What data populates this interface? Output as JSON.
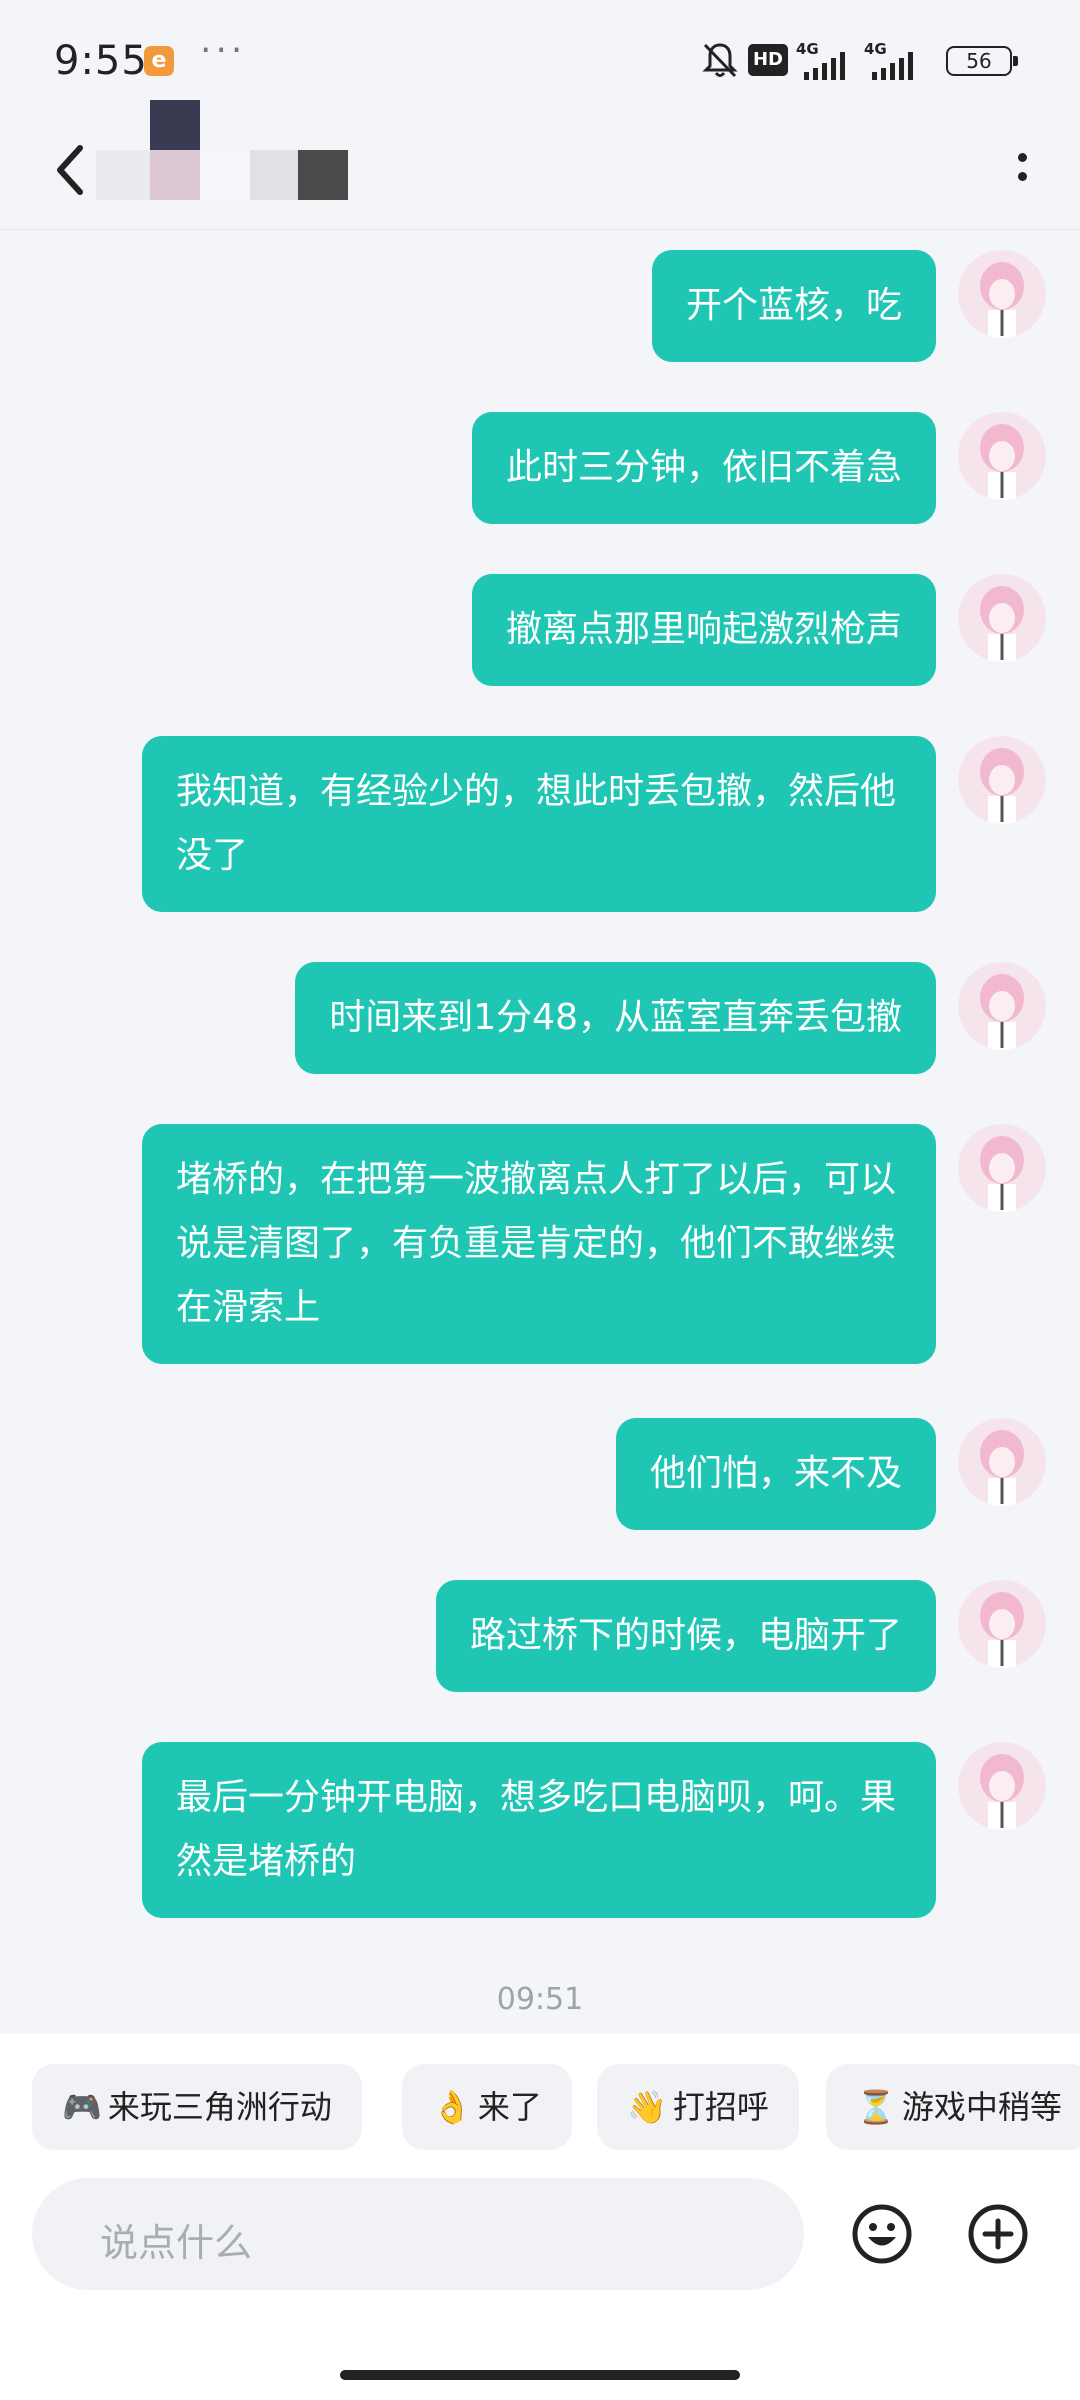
{
  "status_bar": {
    "time": "9:55",
    "app_badge": "e",
    "more": "···",
    "hd_label": "HD",
    "net1": "4G",
    "net2": "4G",
    "battery": "56"
  },
  "messages": [
    {
      "text": "开个蓝核，吃"
    },
    {
      "text": "此时三分钟，依旧不着急"
    },
    {
      "text": "撤离点那里响起激烈枪声"
    },
    {
      "text": "我知道，有经验少的，想此时丢包撤，然后他没了"
    },
    {
      "text": "时间来到1分48，从蓝室直奔丢包撤"
    },
    {
      "text": "堵桥的，在把第一波撤离点人打了以后，可以说是清图了，有负重是肯定的，他们不敢继续在滑索上"
    },
    {
      "text": "他们怕，来不及"
    },
    {
      "text": "路过桥下的时候，电脑开了"
    },
    {
      "text": "最后一分钟开电脑，想多吃口电脑呗，呵。果然是堵桥的"
    }
  ],
  "timestamp": "09:51",
  "quick_replies": [
    {
      "icon": "🎮",
      "label": "来玩三角洲行动"
    },
    {
      "icon": "👌",
      "label": "来了"
    },
    {
      "icon": "👋",
      "label": "打招呼"
    },
    {
      "icon": "⏳",
      "label": "游戏中稍等"
    }
  ],
  "input": {
    "placeholder": "说点什么"
  },
  "colors": {
    "bubble": "#1ec6b3",
    "background": "#f4f5f9",
    "panel": "#ffffff"
  }
}
